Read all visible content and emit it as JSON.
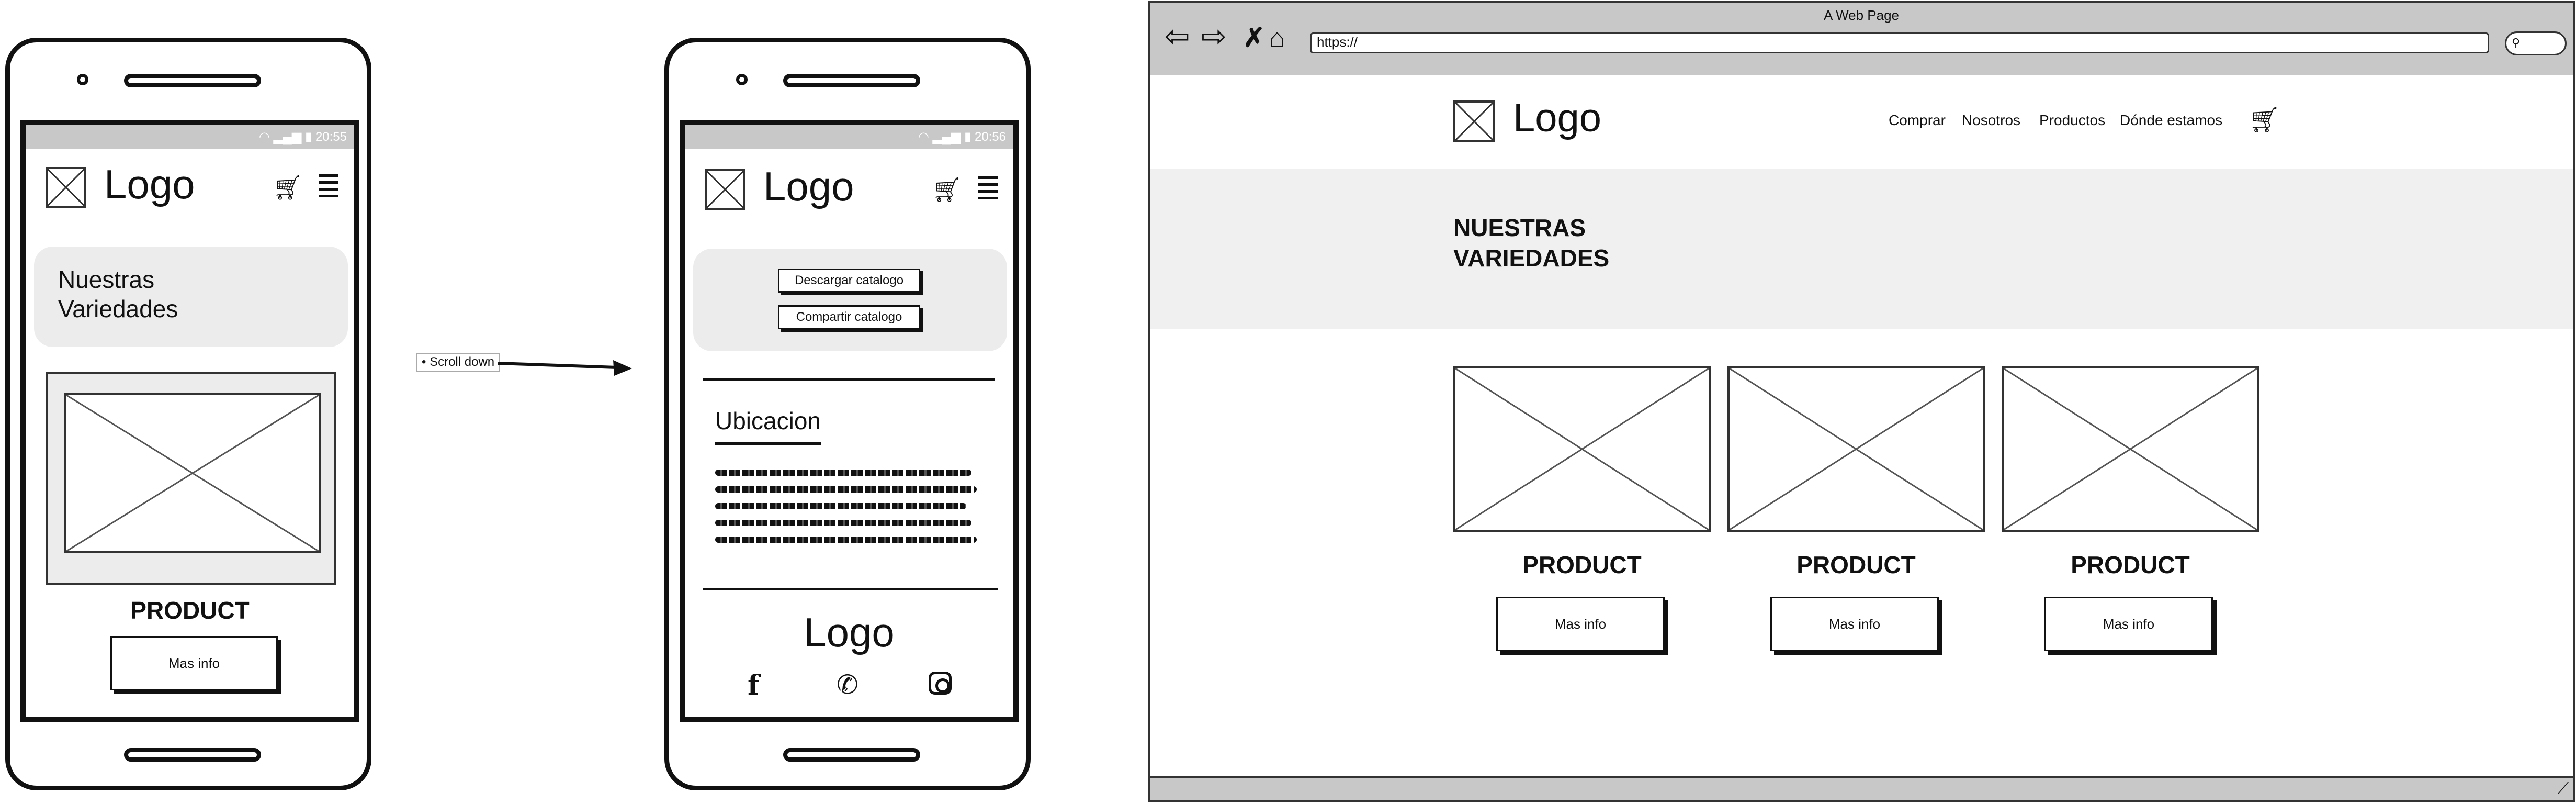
{
  "connector": {
    "label": "Scroll down"
  },
  "phone1": {
    "status_time": "20:55",
    "logo": "Logo",
    "hero_line1": "Nuestras",
    "hero_line2": "Variedades",
    "product_title": "PRODUCT",
    "button_label": "Mas info",
    "icons": [
      "wifi-icon",
      "signal-icon",
      "battery-icon",
      "cart-icon",
      "hamburger-menu-icon",
      "image-placeholder-icon"
    ]
  },
  "phone2": {
    "status_time": "20:56",
    "logo": "Logo",
    "download_button": "Descargar catalogo",
    "share_button": "Compartir catalogo",
    "section_title": "Ubicacion",
    "footer_logo": "Logo",
    "social_icons": [
      "facebook-icon",
      "phone-icon",
      "instagram-icon"
    ]
  },
  "browser": {
    "window_title": "A Web Page",
    "url": "https://",
    "logo": "Logo",
    "nav": [
      "Comprar",
      "Nosotros",
      "Productos",
      "Dónde estamos"
    ],
    "hero_line1": "NUESTRAS",
    "hero_line2": "VARIEDADES",
    "products": [
      {
        "title": "PRODUCT",
        "button": "Mas info"
      },
      {
        "title": "PRODUCT",
        "button": "Mas info"
      },
      {
        "title": "PRODUCT",
        "button": "Mas info"
      }
    ]
  }
}
